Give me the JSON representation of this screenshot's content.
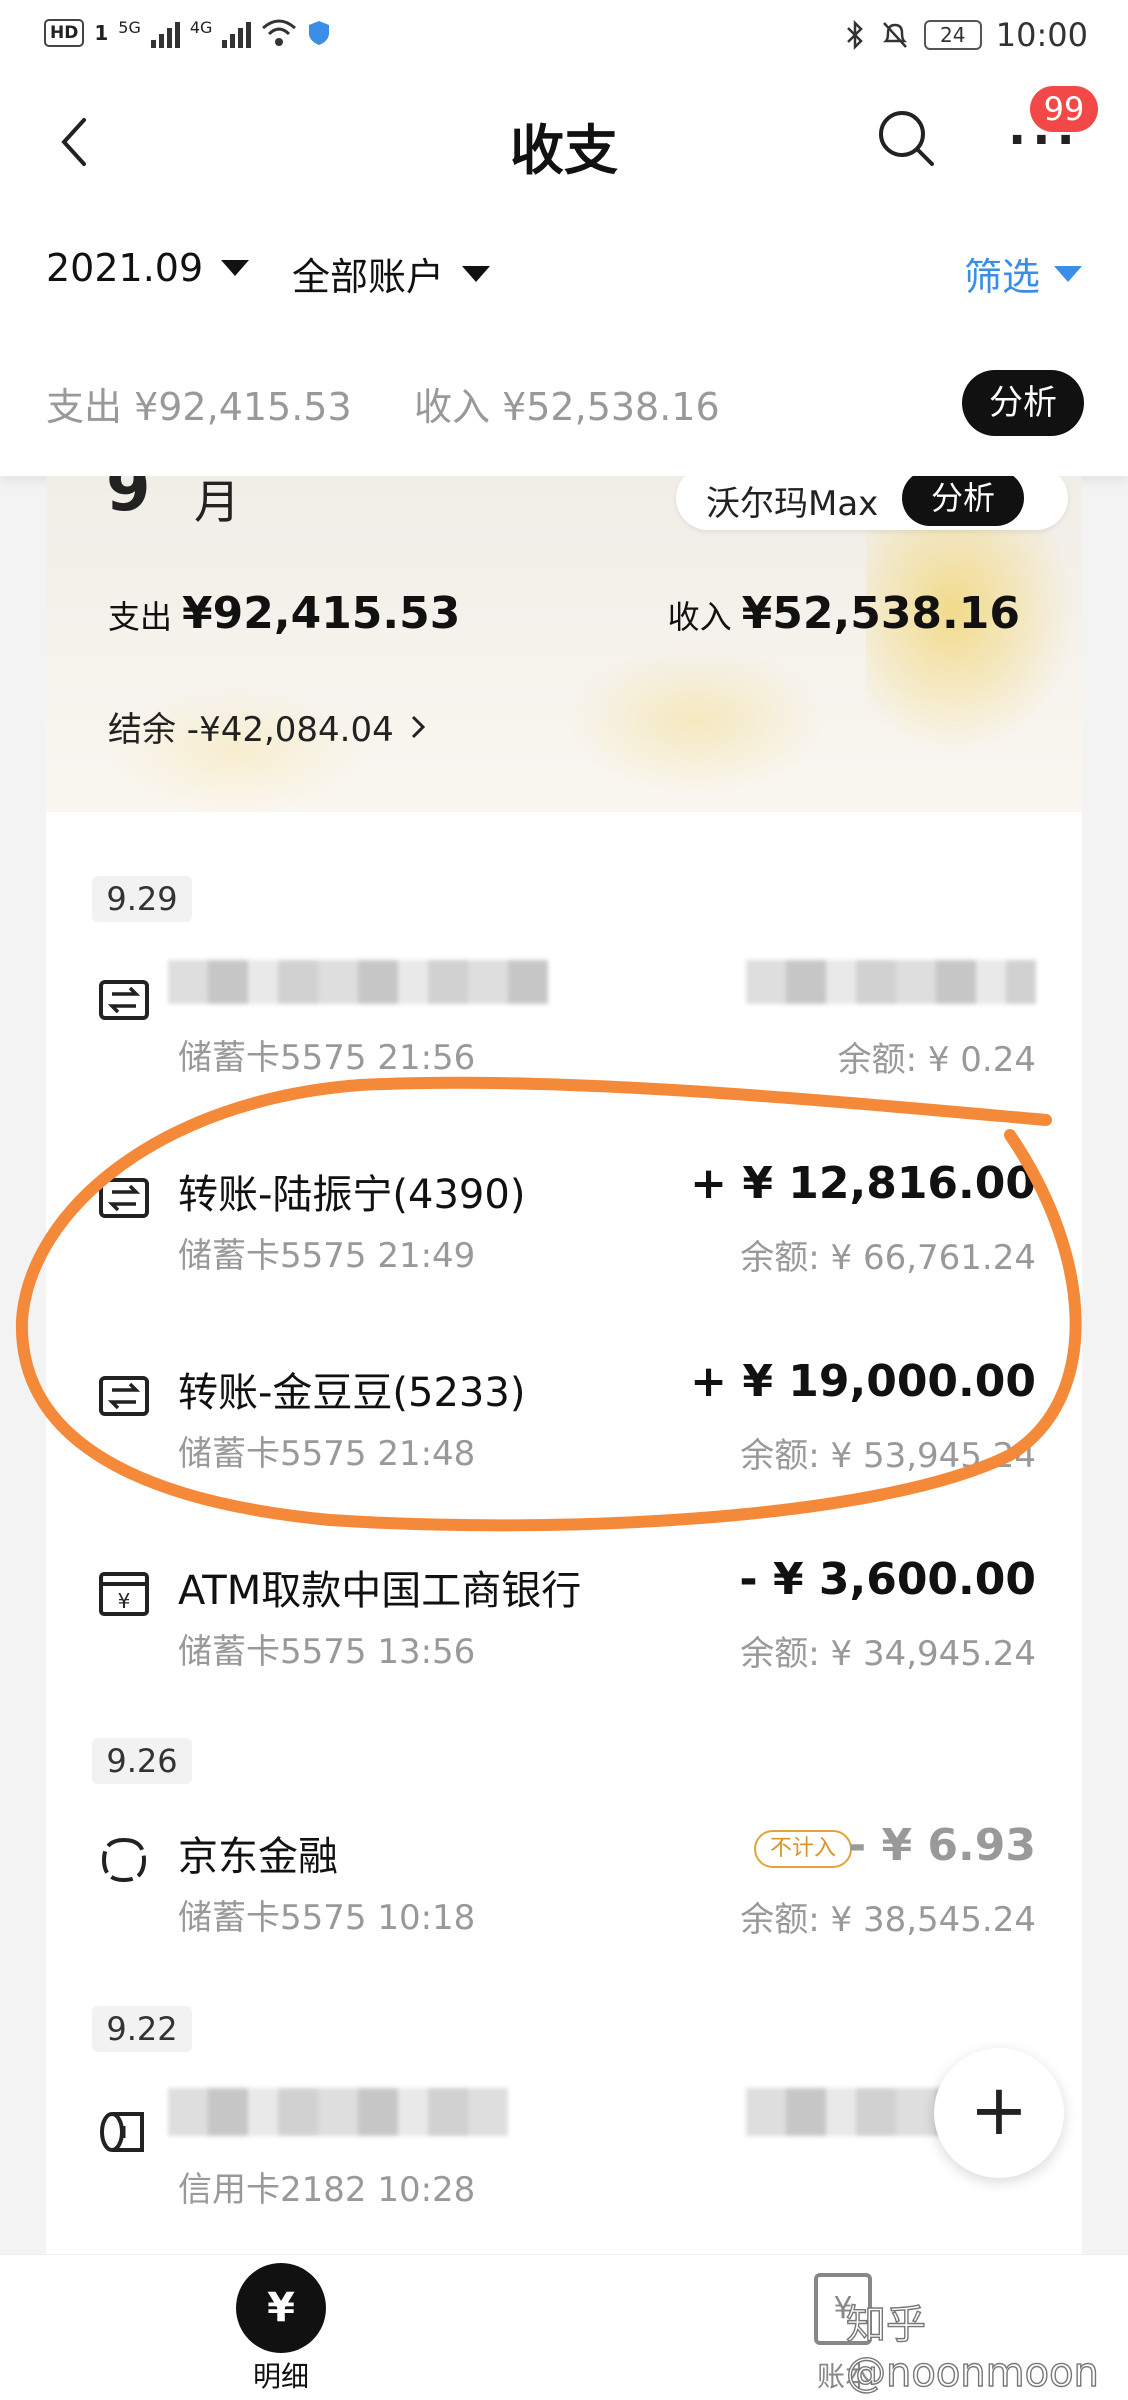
{
  "status_bar": {
    "hd": "HD",
    "sim": "1",
    "net1": "5G",
    "net2": "4G",
    "battery": "24",
    "time": "10:00"
  },
  "header": {
    "title": "收支",
    "badge": "99"
  },
  "filter": {
    "month": "2021.09",
    "account": "全部账户",
    "screen": "筛选"
  },
  "summary": {
    "expense": "支出 ¥92,415.53",
    "income": "收入 ¥52,538.16",
    "analyze": "分析"
  },
  "banner": {
    "month_num": "9",
    "month_unit": "月",
    "store": "沃尔玛Max",
    "analyze": "分析",
    "expense_label": "支出",
    "expense_value": "¥92,415.53",
    "income_label": "收入",
    "income_value": "¥52,538.16",
    "balance": "结余 -¥42,084.04"
  },
  "dates": [
    "9.29",
    "9.26",
    "9.22"
  ],
  "transactions": [
    {
      "title": "",
      "sub": "储蓄卡5575 21:56",
      "amount": "",
      "balance": "余额: ¥ 0.24",
      "icon": "transfer-icon"
    },
    {
      "title": "转账-陆振宁(4390)",
      "sub": "储蓄卡5575 21:49",
      "amount": "+ ¥ 12,816.00",
      "balance": "余额: ¥ 66,761.24",
      "icon": "transfer-icon"
    },
    {
      "title": "转账-金豆豆(5233)",
      "sub": "储蓄卡5575 21:48",
      "amount": "+ ¥ 19,000.00",
      "balance": "余额: ¥ 53,945.24",
      "icon": "transfer-icon"
    },
    {
      "title": "ATM取款中国工商银行",
      "sub": "储蓄卡5575 13:56",
      "amount": "- ¥ 3,600.00",
      "balance": "余额: ¥ 34,945.24",
      "icon": "atm-icon"
    },
    {
      "title": "京东金融",
      "sub": "储蓄卡5575 10:18",
      "amount": "- ¥ 6.93",
      "balance": "余额: ¥ 38,545.24",
      "tag": "不计入",
      "icon": "finance-icon"
    },
    {
      "title": "",
      "sub": "信用卡2182 10:28",
      "amount": "",
      "balance": "",
      "icon": "roll-icon"
    }
  ],
  "fab": "+",
  "bottom_nav": {
    "detail": "明细",
    "ledger": "账本"
  },
  "watermark": "知乎@noonmoon",
  "colors": {
    "accent_blue": "#3a8ee6",
    "badge_red": "#f24848",
    "annotation_orange": "#f5893a",
    "tag_orange": "#d8952a"
  }
}
